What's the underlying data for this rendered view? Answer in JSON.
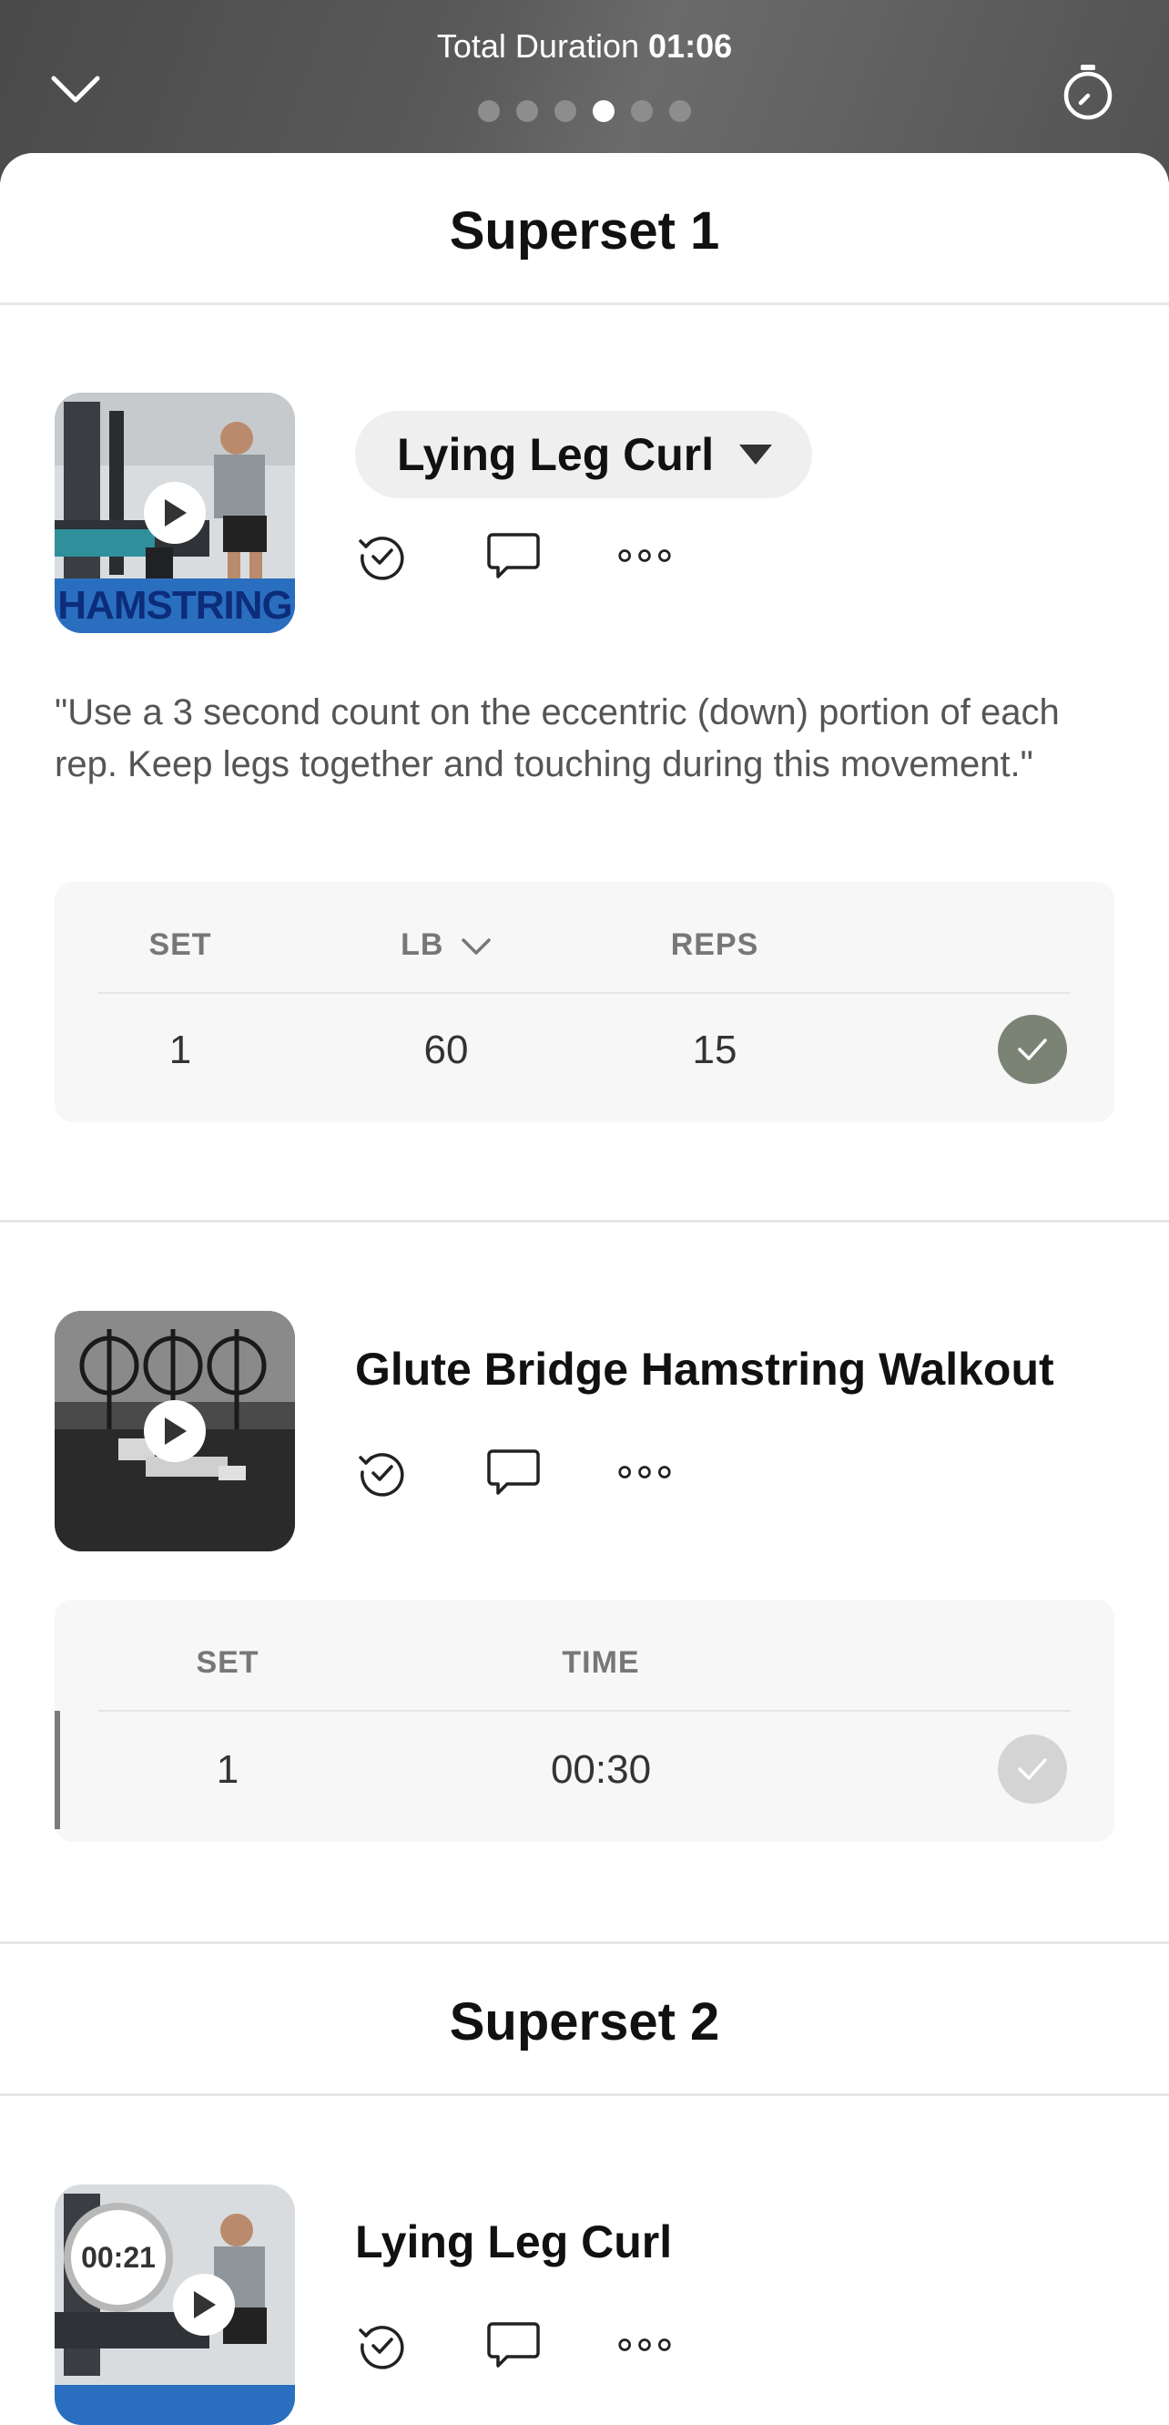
{
  "header": {
    "duration_label": "Total Duration",
    "duration_value": "01:06",
    "page_dots": 6,
    "active_dot_index": 3
  },
  "supersets": [
    {
      "title": "Superset 1",
      "exercises": [
        {
          "name": "Lying Leg Curl",
          "thumb_banner": "HAMSTRING",
          "note": "\"Use a 3 second count on the eccentric (down) portion of each rep. Keep legs together and touching during this movement.\"",
          "table": {
            "headers": [
              "SET",
              "LB",
              "REPS"
            ],
            "rows": [
              {
                "set": "1",
                "lb": "60",
                "reps": "15",
                "done": true
              }
            ]
          }
        },
        {
          "name": "Glute Bridge Hamstring Walkout",
          "table": {
            "headers": [
              "SET",
              "TIME"
            ],
            "rows": [
              {
                "set": "1",
                "time": "00:30",
                "done": false
              }
            ]
          }
        }
      ]
    },
    {
      "title": "Superset 2",
      "exercises": [
        {
          "name": "Lying Leg Curl",
          "rest_timer": "00:21"
        }
      ]
    }
  ],
  "colors": {
    "check_done": "#7b8375",
    "check_pending": "#d4d4d4",
    "thumb_banner_bg": "#2a6fbf"
  }
}
